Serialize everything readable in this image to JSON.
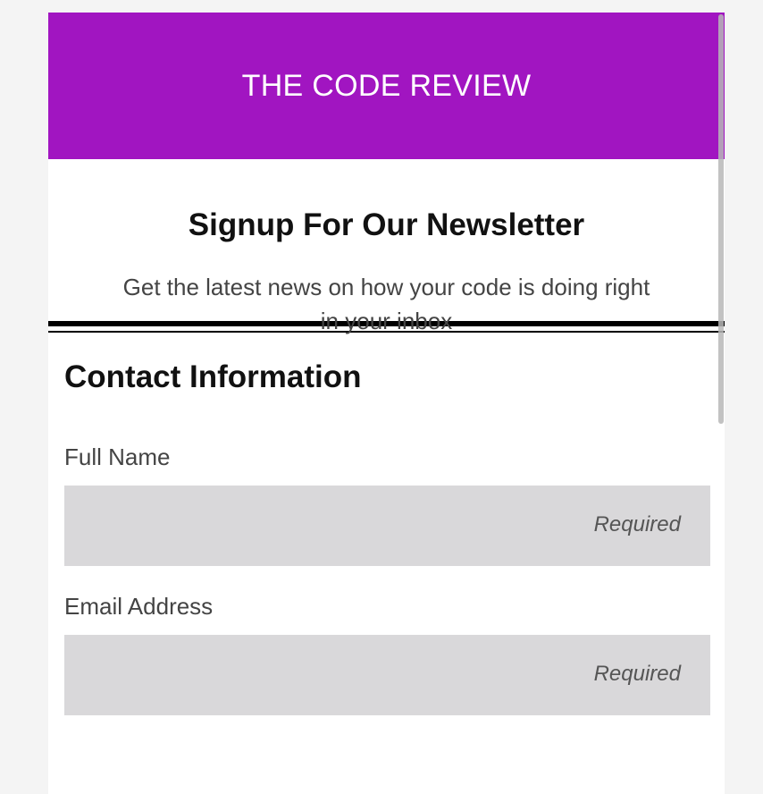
{
  "header": {
    "brand": "THE CODE REVIEW",
    "bg_color": "#a115c1"
  },
  "intro": {
    "title": "Signup For Our Newsletter",
    "subtitle": "Get the latest news on how your code is doing right in your inbox"
  },
  "form": {
    "section_title": "Contact Information",
    "fields": [
      {
        "label": "Full Name",
        "value": "",
        "hint": "Required"
      },
      {
        "label": "Email Address",
        "value": "",
        "hint": "Required"
      }
    ]
  }
}
